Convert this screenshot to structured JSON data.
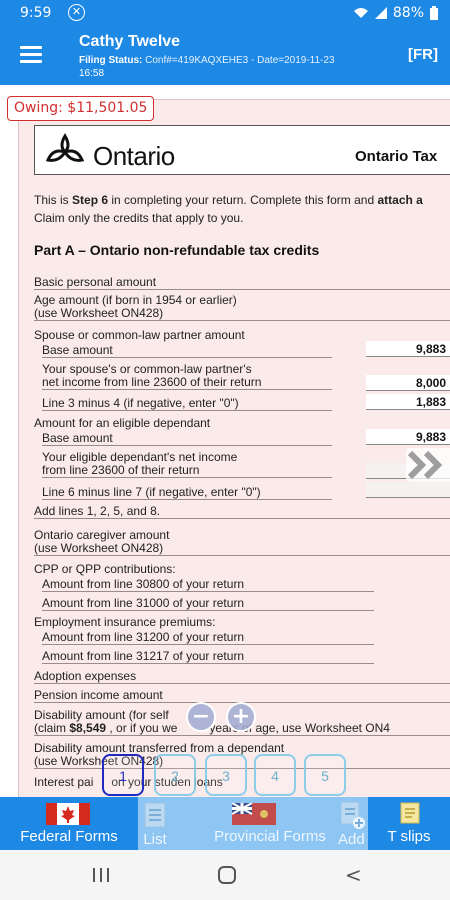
{
  "status_bar": {
    "time": "9:59",
    "battery": "88%"
  },
  "header": {
    "title": "Cathy Twelve",
    "filing_label": "Filing Status:",
    "filing_conf": "Conf#=419KAQXEHE3",
    "filing_date": "Date=2019-11-23",
    "filing_time": "16:58",
    "language_button": "[FR]"
  },
  "owing": "Owing: $11,501.05",
  "form": {
    "logo_text": "Ontario",
    "form_title": "Ontario Tax",
    "intro_line1_pre": "This is ",
    "intro_step": "Step 6",
    "intro_line1_post": " in completing your return. Complete this form and ",
    "intro_attach": "attach a",
    "intro_line2": "Claim only the credits that apply to you.",
    "part_a": "Part A – Ontario non-refundable tax credits",
    "rows": {
      "basic": "Basic personal amount",
      "age1": "Age amount (if born in 1954 or earlier)",
      "age2": "(use Worksheet ON428)",
      "spouse": "Spouse or common-law partner amount",
      "base1": "Base amount",
      "spouse_inc1": "Your spouse's or common-law partner's",
      "spouse_inc2": "net income from line 23600 of their return",
      "line3": "Line 3 minus 4 (if negative, enter \"0\")",
      "eligible": "Amount for an eligible dependant",
      "base2": "Base amount",
      "dep_inc1": "Your eligible dependant's net income",
      "dep_inc2": "from line 23600 of their return",
      "line6": "Line 6 minus line 7 (if negative, enter \"0\")",
      "add_lines": "Add lines 1, 2, 5, and 8.",
      "caregiver1": "Ontario caregiver amount",
      "caregiver2": "(use Worksheet ON428)",
      "cpp": "CPP or QPP contributions:",
      "cpp1": "Amount from line 30800 of your return",
      "cpp2": "Amount from line 31000 of your return",
      "ei": "Employment insurance premiums:",
      "ei1": "Amount from line 31200 of your return",
      "ei2": "Amount from line 31217 of your return",
      "adoption": "Adoption expenses",
      "pension": "Pension income amount",
      "disability1": "Disability amount (for self",
      "disability2_pre": "(claim ",
      "disability2_amt": "$8,549",
      "disability2_mid": " , or if you we",
      "disability2_post": "years of age, use Worksheet ON4",
      "transfer1": "Disability amount transferred from a dependant",
      "transfer2": "(use Worksheet ON428)",
      "interest1": "Interest pai",
      "interest2": "on your studen loans"
    },
    "amounts": {
      "base1": "9,883",
      "spouse_inc": "8,000",
      "line3": "1,883",
      "base2": "9,883"
    },
    "signs": {
      "minus": "–",
      "equals": "="
    }
  },
  "zoom": {
    "out": "−",
    "in": "+"
  },
  "pages": [
    "1",
    "2",
    "3",
    "4",
    "5"
  ],
  "bottom_tabs": {
    "federal": "Federal Forms",
    "list": "List",
    "provincial": "Provincial Forms",
    "add": "Add",
    "tslips": "T slips"
  },
  "colors": {
    "primary": "#1e88e5",
    "owing": "#d32f2f",
    "form_bg": "#fbeaea"
  }
}
